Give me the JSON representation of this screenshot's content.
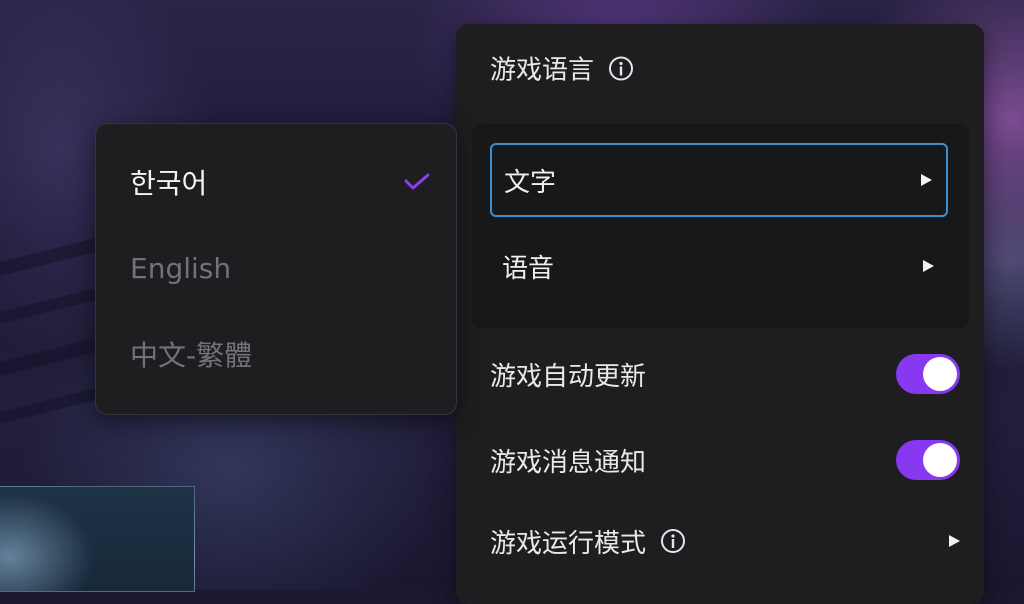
{
  "settings": {
    "game_language": {
      "title": "游戏语言",
      "info_icon": "info-icon",
      "items": [
        {
          "label": "文字",
          "arrow_icon": "chevron-right-icon",
          "active": true
        },
        {
          "label": "语音",
          "arrow_icon": "chevron-right-icon",
          "active": false
        }
      ]
    },
    "auto_update": {
      "label": "游戏自动更新",
      "enabled": true
    },
    "notifications": {
      "label": "游戏消息通知",
      "enabled": true
    },
    "run_mode": {
      "label": "游戏运行模式",
      "info_icon": "info-icon",
      "arrow_icon": "chevron-right-icon"
    }
  },
  "language_dropdown": {
    "options": [
      {
        "label": "한국어",
        "selected": true
      },
      {
        "label": "English",
        "selected": false
      },
      {
        "label": "中文-繁體",
        "selected": false
      }
    ],
    "check_icon": "check-icon"
  },
  "colors": {
    "accent": "#8838f0",
    "focus_border": "#3d8fcf",
    "panel": "#1e1e21"
  }
}
